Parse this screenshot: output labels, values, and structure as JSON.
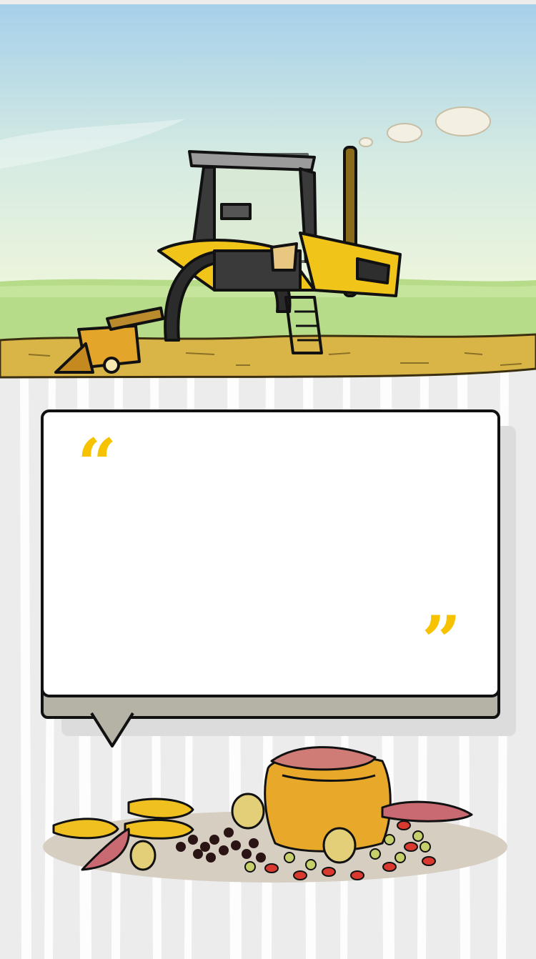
{
  "colors": {
    "sky_top": "#a8d2ea",
    "grass": "#b6dc8a",
    "soil": "#d9b548",
    "tractor_yellow": "#f0c419",
    "quote_mark": "#f7c200",
    "card_base": "#b5b3a5"
  },
  "hero": {
    "illustration": "tractor-in-field"
  },
  "quote_card": {
    "open_mark": "“",
    "close_mark": "”",
    "text": ""
  },
  "footer_illustration": "produce-sack-with-corn-beans-potatoes"
}
